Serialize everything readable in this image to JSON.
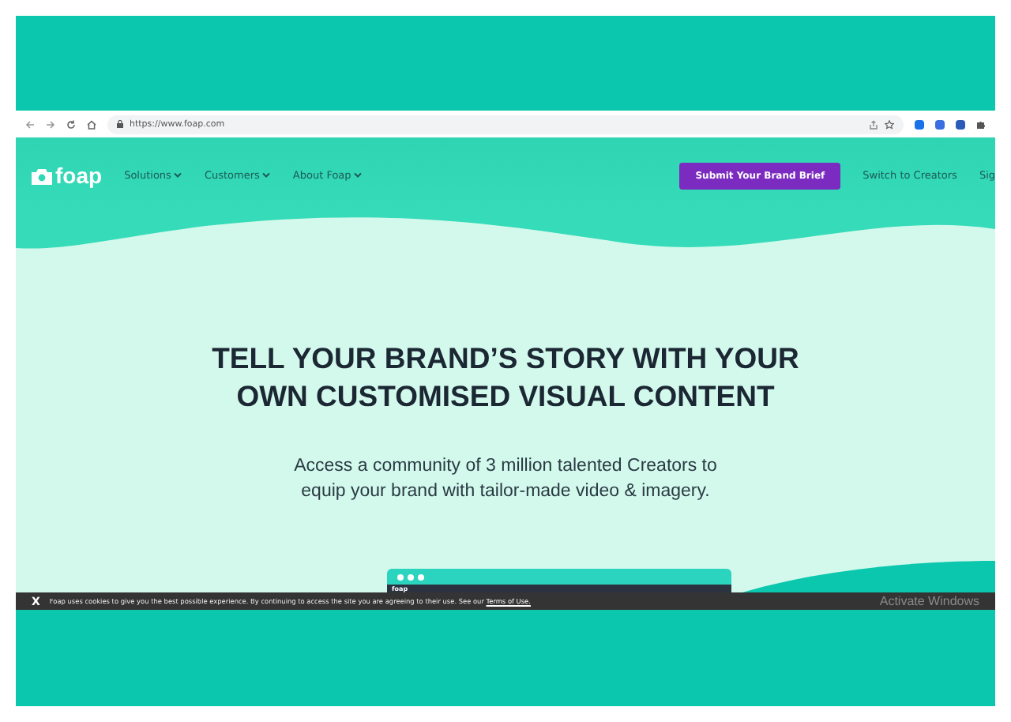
{
  "browser": {
    "url": "https://www.foap.com"
  },
  "nav": {
    "logo": "foap",
    "menu": [
      {
        "label": "Solutions"
      },
      {
        "label": "Customers"
      },
      {
        "label": "About Foap"
      }
    ],
    "cta": "Submit Your Brand Brief",
    "links": [
      "Switch to Creators",
      "Sig"
    ]
  },
  "hero": {
    "title_lines": [
      "TELL YOUR BRAND’S STORY WITH YOUR",
      "OWN CUSTOMISED VISUAL CONTENT"
    ],
    "subtitle_lines": [
      "Access a community of 3 million talented Creators to",
      "equip your brand with tailor-made video & imagery."
    ],
    "mockup_logo": "foap"
  },
  "cookie_bar": {
    "close": "X",
    "text": "Foap uses cookies to give you the best possible experience. By continuing to access the site you are agreeing to their use. See our",
    "link": "Terms of Use."
  },
  "os_notice": "Activate Windows"
}
